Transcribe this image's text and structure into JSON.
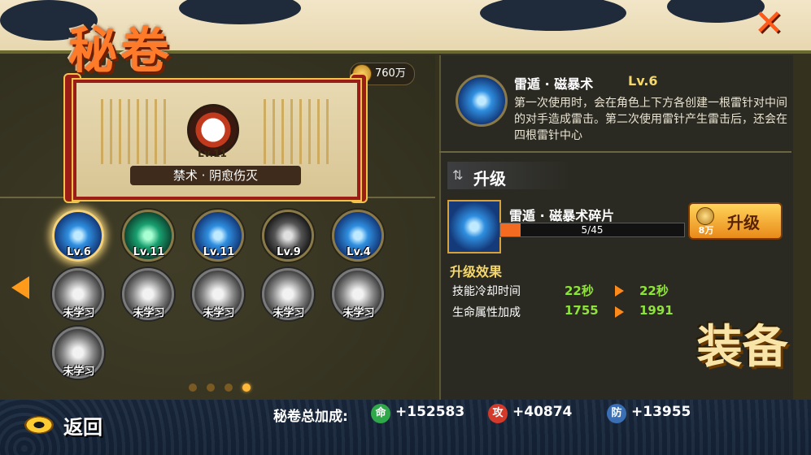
{
  "header": {
    "title": "秘卷",
    "close_icon": "close-x-icon"
  },
  "currency": {
    "amount": "760万",
    "icon": "coin-icon"
  },
  "scroll": {
    "level": "Lv.11",
    "name": "禁术 · 阴愈伤灭"
  },
  "skills": [
    {
      "label": "Lv.6",
      "state": "learned",
      "selected": true
    },
    {
      "label": "Lv.11",
      "state": "learned"
    },
    {
      "label": "Lv.11",
      "state": "learned"
    },
    {
      "label": "Lv.9",
      "state": "learned"
    },
    {
      "label": "Lv.4",
      "state": "learned"
    },
    {
      "label": "未学习",
      "state": "locked"
    },
    {
      "label": "未学习",
      "state": "locked"
    },
    {
      "label": "未学习",
      "state": "locked"
    },
    {
      "label": "未学习",
      "state": "locked"
    },
    {
      "label": "未学习",
      "state": "locked"
    },
    {
      "label": "未学习",
      "state": "locked"
    }
  ],
  "pagination": {
    "pages": 4,
    "active": 4
  },
  "detail": {
    "name": "雷遁 · 磁暴术",
    "level": "Lv.6",
    "description": "第一次使用时，会在角色上下方各创建一根雷针对中间的对手造成雷击。第二次使用雷针产生雷击后，还会在四根雷针中心"
  },
  "upgrade": {
    "section_title": "升级",
    "fragment_name": "雷遁 · 磁暴术碎片",
    "progress_text": "5/45",
    "progress_fraction": 0.111,
    "cost": "8万",
    "button_label": "升级"
  },
  "effects": {
    "title": "升级效果",
    "rows": [
      {
        "label": "技能冷却时间",
        "from": "22秒",
        "to": "22秒"
      },
      {
        "label": "生命属性加成",
        "from": "1755",
        "to": "1991"
      }
    ]
  },
  "equip_label": "装备",
  "footer": {
    "back_label": "返回",
    "totals_label": "秘卷总加成:",
    "stats": [
      {
        "badge": "命",
        "value": "+152583",
        "color": "#2fa84a"
      },
      {
        "badge": "攻",
        "value": "+40874",
        "color": "#d33a2a"
      },
      {
        "badge": "防",
        "value": "+13955",
        "color": "#3a6fb5"
      }
    ]
  },
  "colors": {
    "accent": "#ff7b2a",
    "gold": "#f5d76a",
    "green": "#8ee33a"
  }
}
